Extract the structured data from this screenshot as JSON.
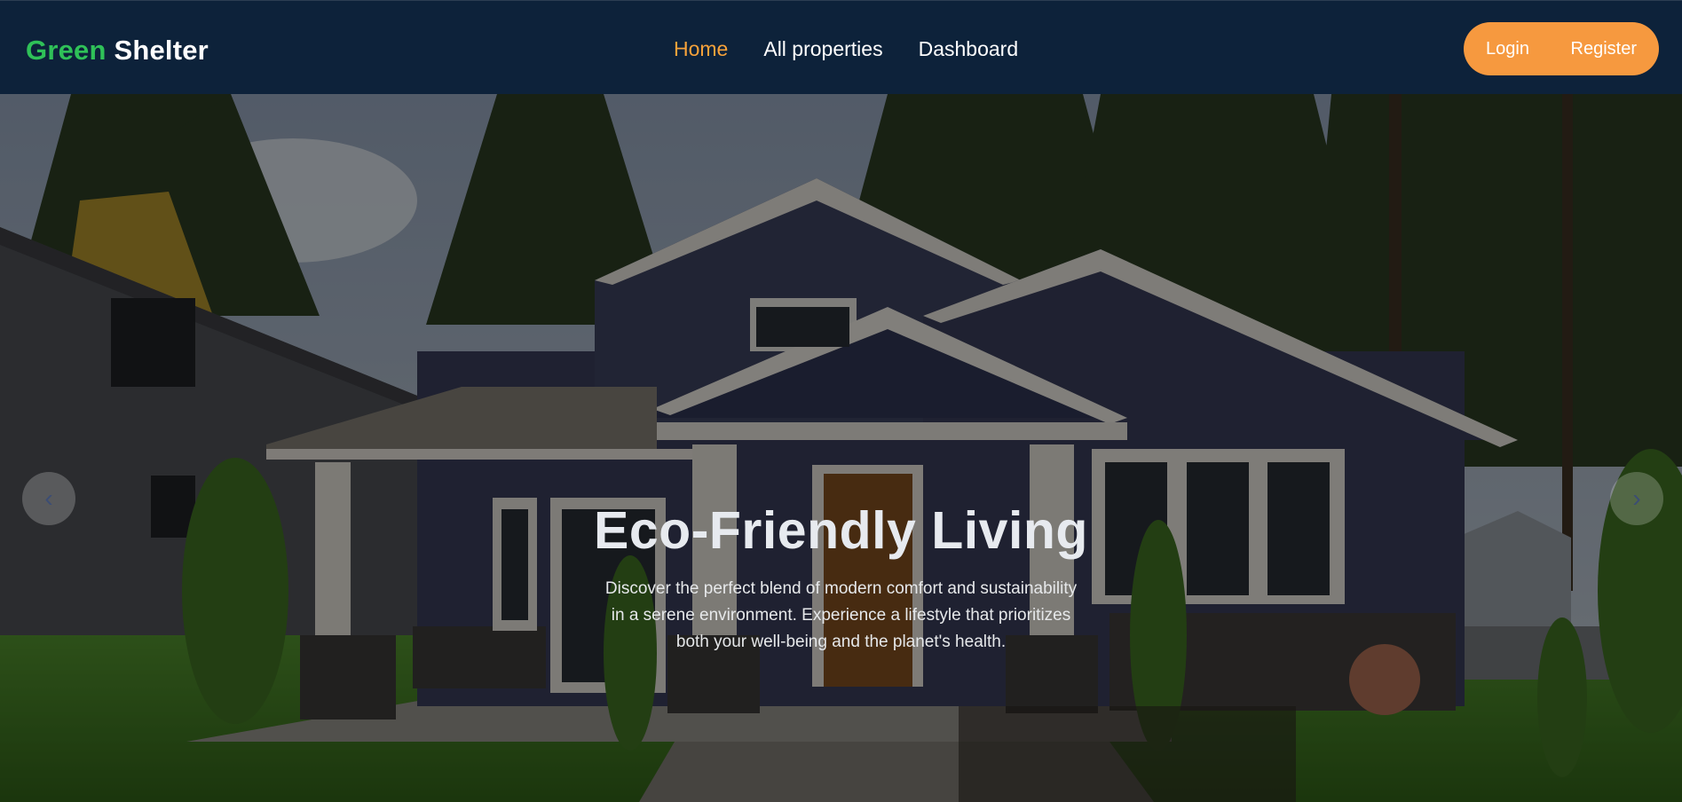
{
  "navbar": {
    "brand_primary": "Green",
    "brand_secondary": "Shelter",
    "links": [
      {
        "label": "Home",
        "active": true
      },
      {
        "label": "All properties",
        "active": false
      },
      {
        "label": "Dashboard",
        "active": false
      }
    ],
    "login_label": "Login",
    "register_label": "Register"
  },
  "hero": {
    "title": "Eco-Friendly Living",
    "description": "Discover the perfect blend of modern comfort and sustainability in a serene environment. Experience a lifestyle that prioritizes both your well-being and the planet's health.",
    "prev_icon": "chevron-left-icon",
    "next_icon": "chevron-right-icon",
    "prev_glyph": "‹",
    "next_glyph": "›"
  },
  "colors": {
    "navbar_bg": "#0d223a",
    "brand_green": "#2fc158",
    "active_link": "#f7a23a",
    "auth_button_bg": "#f6993f"
  }
}
